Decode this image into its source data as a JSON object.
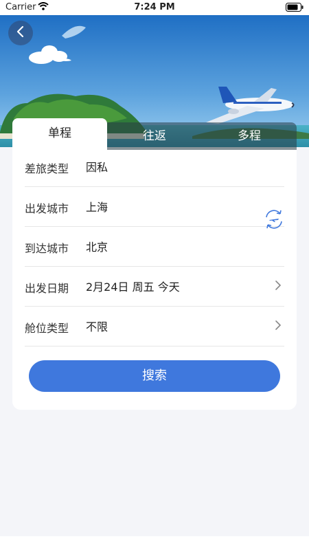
{
  "status_bar": {
    "carrier": "Carrier",
    "time": "7:24 PM"
  },
  "icons": {
    "back": "chevron-left-icon",
    "wifi": "wifi-icon",
    "battery": "battery-icon",
    "swap": "swap-cities-icon",
    "chevron": "chevron-right-icon"
  },
  "tabs": [
    {
      "label": "单程",
      "active": true
    },
    {
      "label": "往返",
      "active": false
    },
    {
      "label": "多程",
      "active": false
    }
  ],
  "form": {
    "rows": [
      {
        "label": "差旅类型",
        "value": "因私"
      },
      {
        "label": "出发城市",
        "value": "上海"
      },
      {
        "label": "到达城市",
        "value": "北京"
      },
      {
        "label": "出发日期",
        "value": "2月24日 周五 今天"
      },
      {
        "label": "舱位类型",
        "value": "不限"
      }
    ]
  },
  "search_label": "搜索",
  "colors": {
    "accent": "#3f78dd",
    "background": "#f4f5f9"
  }
}
